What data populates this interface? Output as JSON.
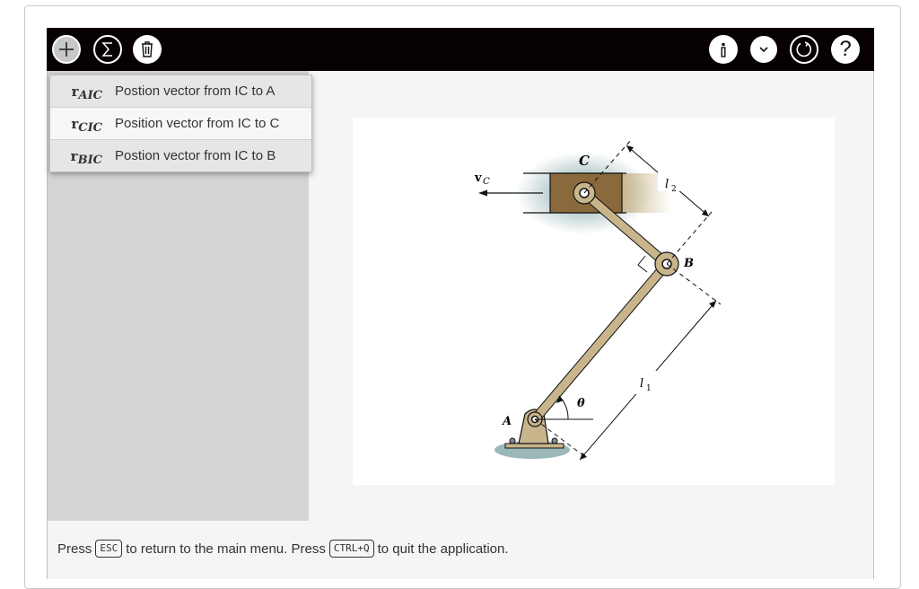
{
  "toolbar": {
    "add_icon": "plus-icon",
    "sum_icon": "sigma-icon",
    "trash_icon": "trash-icon",
    "info_icon": "info-icon",
    "collapse_icon": "chevron-down-icon",
    "reset_icon": "reset-icon",
    "help_label": "?"
  },
  "dropdown": {
    "items": [
      {
        "sym": "r",
        "sub": "AIC",
        "label": "Postion vector from IC to A"
      },
      {
        "sym": "r",
        "sub": "CIC",
        "label": "Position vector from IC to C"
      },
      {
        "sym": "r",
        "sub": "BIC",
        "label": "Postion vector from IC to B"
      }
    ]
  },
  "figure": {
    "label_c": "C",
    "label_b": "B",
    "label_a": "A",
    "label_vc": "v",
    "label_vc_sub": "C",
    "label_l1": "l",
    "label_l1_sub": "1",
    "label_l2": "l",
    "label_l2_sub": "2",
    "label_theta": "θ"
  },
  "footer": {
    "press1": "Press",
    "esc_key": "ESC",
    "mid_text": "to return to the main menu. Press",
    "quit_key": "CTRL+Q",
    "end_text": "to quit the application."
  },
  "colors": {
    "toolbar_bg": "#070000",
    "panel_bg": "#d4d4d4",
    "link_color": "#c8b58c",
    "block_color": "#8a6a3c"
  }
}
